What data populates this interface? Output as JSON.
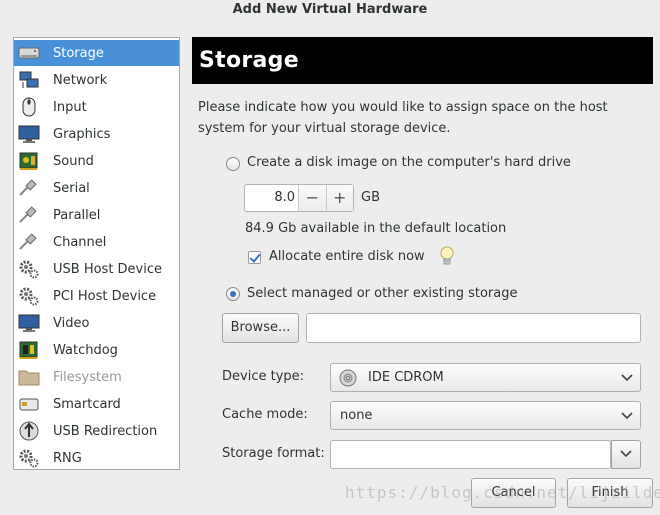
{
  "window": {
    "title": "Add New Virtual Hardware"
  },
  "sidebar": {
    "items": [
      {
        "label": "Storage",
        "icon": "disk-icon",
        "selected": true
      },
      {
        "label": "Network",
        "icon": "network-icon"
      },
      {
        "label": "Input",
        "icon": "mouse-icon"
      },
      {
        "label": "Graphics",
        "icon": "monitor-icon"
      },
      {
        "label": "Sound",
        "icon": "sound-card-icon"
      },
      {
        "label": "Serial",
        "icon": "serial-plug-icon"
      },
      {
        "label": "Parallel",
        "icon": "parallel-plug-icon"
      },
      {
        "label": "Channel",
        "icon": "channel-plug-icon"
      },
      {
        "label": "USB Host Device",
        "icon": "usb-gear-icon"
      },
      {
        "label": "PCI Host Device",
        "icon": "pci-gear-icon"
      },
      {
        "label": "Video",
        "icon": "video-monitor-icon"
      },
      {
        "label": "Watchdog",
        "icon": "watchdog-chip-icon"
      },
      {
        "label": "Filesystem",
        "icon": "folder-icon",
        "disabled": true
      },
      {
        "label": "Smartcard",
        "icon": "smartcard-icon"
      },
      {
        "label": "USB Redirection",
        "icon": "usb-redirection-icon"
      },
      {
        "label": "RNG",
        "icon": "rng-gear-icon"
      }
    ]
  },
  "main": {
    "header": "Storage",
    "description_line1": "Please indicate how you would like to assign space on the host",
    "description_line2": "system for your virtual storage device.",
    "create_disk_label": "Create a disk image on the computer's hard drive",
    "size_value": "8.0",
    "size_minus": "−",
    "size_plus": "+",
    "size_unit": "GB",
    "available_text": "84.9 Gb available in the default location",
    "allocate_label": "Allocate entire disk now",
    "select_existing_label": "Select managed or other existing storage",
    "browse_label": "Browse...",
    "storage_path_value": "",
    "device_type_label": "Device type:",
    "device_type_value": "IDE CDROM",
    "cache_mode_label": "Cache mode:",
    "cache_mode_value": "none",
    "storage_format_label": "Storage format:",
    "storage_format_value": ""
  },
  "footer": {
    "cancel_label": "Cancel",
    "finish_label": "Finish",
    "watermark": "https://blog.csdn.net/lijzilde"
  },
  "colors": {
    "selection": "#4a90d9",
    "header_bg": "#000000",
    "window_bg": "#ededed"
  }
}
